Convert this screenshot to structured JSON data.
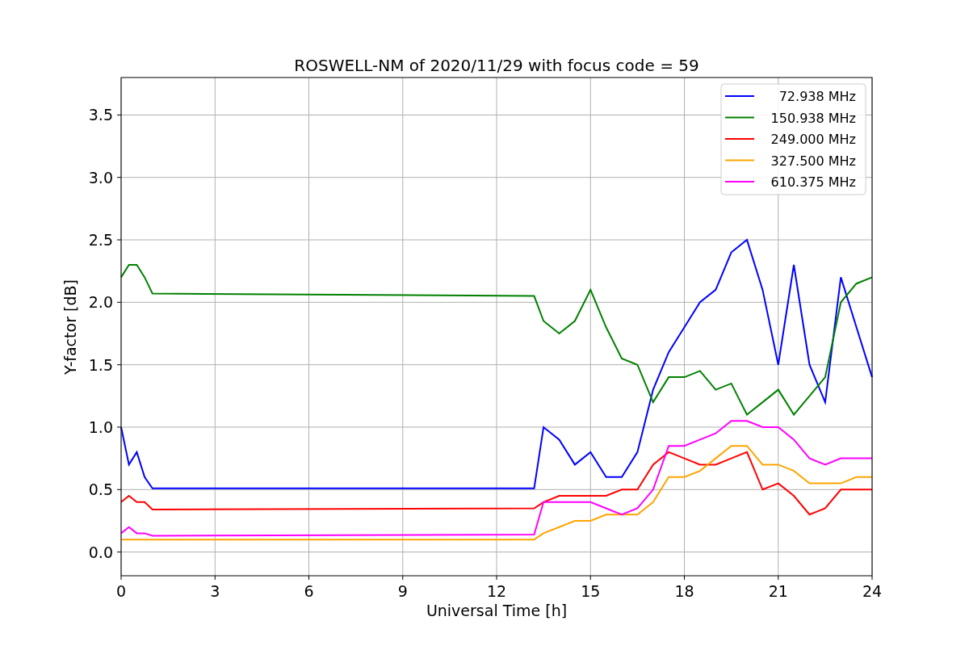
{
  "figure": {
    "chart_data": {
      "type": "line",
      "title": "ROSWELL-NM of 2020/11/29 with focus code = 59",
      "xlabel": "Universal Time [h]",
      "ylabel": "Y-factor [dB]",
      "x": [
        0,
        0.25,
        0.5,
        0.75,
        1,
        13.2,
        13.5,
        14,
        14.5,
        15,
        15.5,
        16,
        16.5,
        17,
        17.5,
        18,
        18.5,
        19,
        19.5,
        20,
        20.5,
        21,
        21.5,
        22,
        22.5,
        23,
        23.5,
        24
      ],
      "series": [
        {
          "name": "72.938 MHz",
          "color": "#0000ff",
          "values": [
            1.0,
            0.7,
            0.8,
            0.6,
            0.51,
            0.51,
            1.0,
            0.9,
            0.7,
            0.8,
            0.6,
            0.6,
            0.8,
            1.3,
            1.6,
            1.8,
            2.0,
            2.1,
            2.4,
            2.5,
            2.1,
            1.5,
            2.3,
            1.5,
            1.2,
            2.2,
            1.8,
            1.4
          ]
        },
        {
          "name": "150.938 MHz",
          "color": "#008000",
          "values": [
            2.2,
            2.3,
            2.3,
            2.2,
            2.07,
            2.05,
            1.85,
            1.75,
            1.85,
            2.1,
            1.8,
            1.55,
            1.5,
            1.2,
            1.4,
            1.4,
            1.45,
            1.3,
            1.35,
            1.1,
            1.2,
            1.3,
            1.1,
            1.25,
            1.4,
            2.0,
            2.15,
            2.2
          ]
        },
        {
          "name": "249.000 MHz",
          "color": "#ff0000",
          "values": [
            0.4,
            0.45,
            0.4,
            0.4,
            0.34,
            0.35,
            0.4,
            0.45,
            0.45,
            0.45,
            0.45,
            0.5,
            0.5,
            0.7,
            0.8,
            0.75,
            0.7,
            0.7,
            0.75,
            0.8,
            0.5,
            0.55,
            0.45,
            0.3,
            0.35,
            0.5,
            0.5,
            0.5
          ]
        },
        {
          "name": "327.500 MHz",
          "color": "#ffa500",
          "values": [
            0.1,
            0.1,
            0.1,
            0.1,
            0.1,
            0.1,
            0.15,
            0.2,
            0.25,
            0.25,
            0.3,
            0.3,
            0.3,
            0.4,
            0.6,
            0.6,
            0.65,
            0.75,
            0.85,
            0.85,
            0.7,
            0.7,
            0.65,
            0.55,
            0.55,
            0.55,
            0.6,
            0.6
          ]
        },
        {
          "name": "610.375 MHz",
          "color": "#ff00ff",
          "values": [
            0.15,
            0.2,
            0.15,
            0.15,
            0.13,
            0.14,
            0.4,
            0.4,
            0.4,
            0.4,
            0.35,
            0.3,
            0.35,
            0.5,
            0.85,
            0.85,
            0.9,
            0.95,
            1.05,
            1.05,
            1.0,
            1.0,
            0.9,
            0.75,
            0.7,
            0.75,
            0.75,
            0.75
          ]
        }
      ],
      "grid": true,
      "legend": true,
      "xlim": [
        0,
        24
      ],
      "ylim": [
        -0.19,
        3.8
      ],
      "xticks": [
        0,
        3,
        6,
        9,
        12,
        15,
        18,
        21,
        24
      ],
      "yticks": [
        {
          "value": 0,
          "label": "0.0"
        },
        {
          "value": 0.5,
          "label": "0.5"
        },
        {
          "value": 1,
          "label": "1.0"
        },
        {
          "value": 1.5,
          "label": "1.5"
        },
        {
          "value": 2,
          "label": "2.0"
        },
        {
          "value": 2.5,
          "label": "2.5"
        },
        {
          "value": 3,
          "label": "3.0"
        },
        {
          "value": 3.5,
          "label": "3.5"
        }
      ]
    }
  }
}
